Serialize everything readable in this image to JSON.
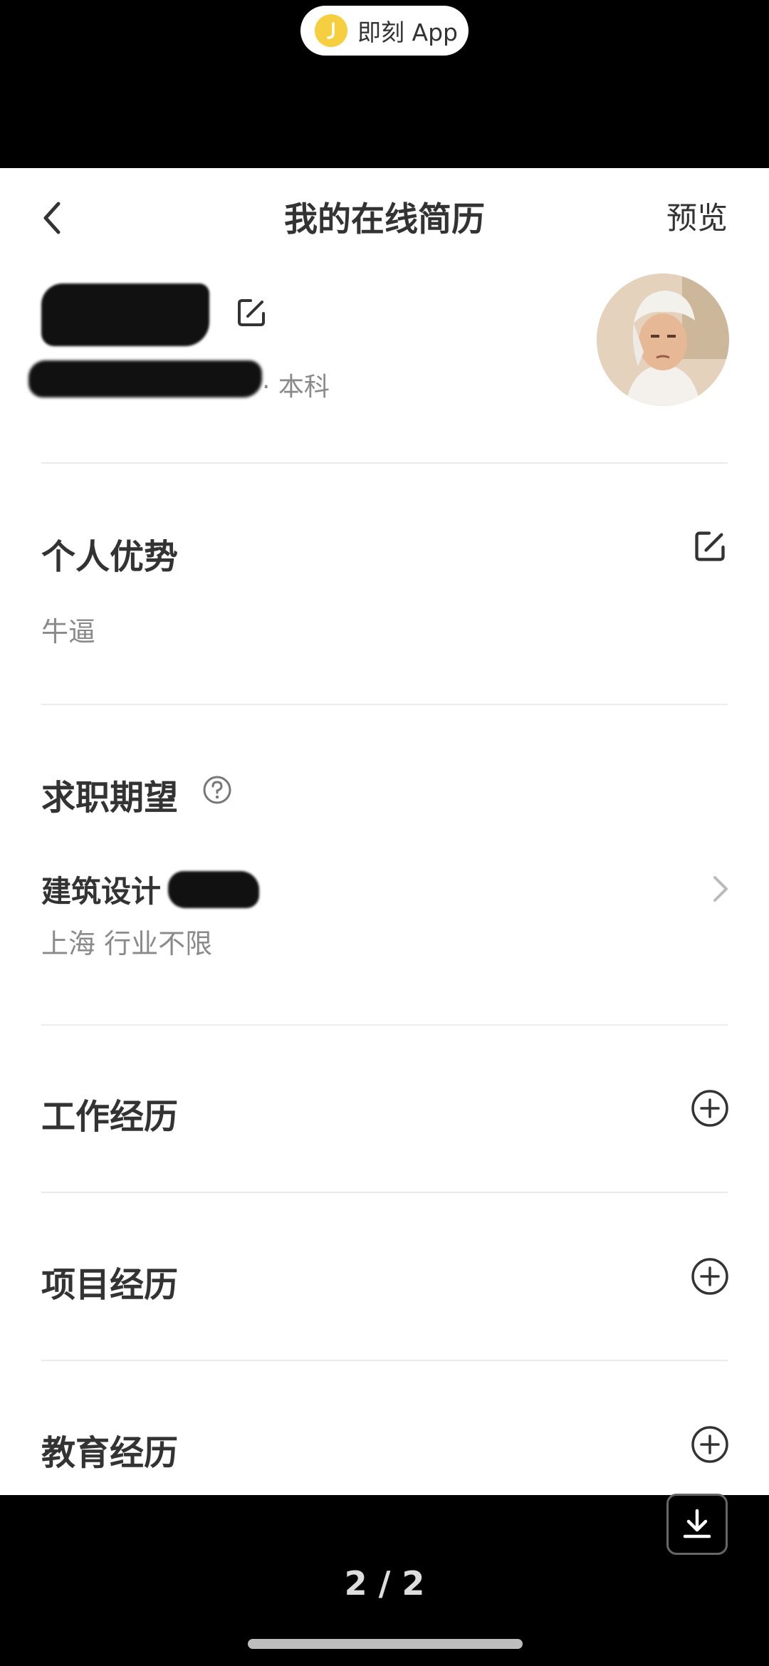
{
  "top_bar": {
    "app_name": "即刻 App"
  },
  "nav": {
    "title": "我的在线简历",
    "preview_label": "预览"
  },
  "profile": {
    "name": "",
    "degree": "· 本科"
  },
  "advantage": {
    "title": "个人优势",
    "text": "牛逼"
  },
  "expectation": {
    "title": "求职期望",
    "job_title": "建筑设计",
    "job_detail": "上海 行业不限"
  },
  "sections": {
    "work": "工作经历",
    "project": "项目经历",
    "education": "教育经历"
  },
  "viewer": {
    "page_indicator": "2 / 2"
  },
  "colors": {
    "text_primary": "#333333",
    "text_secondary": "#8a8a8a",
    "logo_yellow": "#f5cf3f"
  }
}
